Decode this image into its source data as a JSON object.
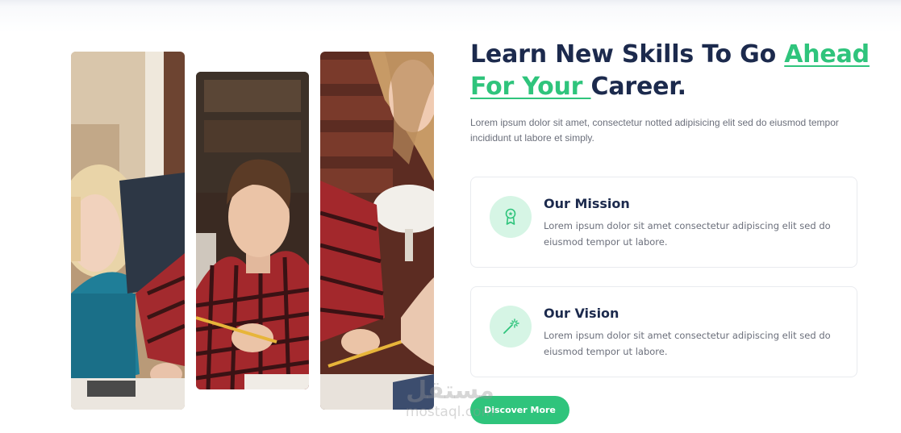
{
  "about": {
    "heading_part1": "Learn New Skills To Go ",
    "heading_accent": "Ahead For Your ",
    "heading_part2": "Career.",
    "intro": "Lorem ipsum dolor sit amet, consectetur notted adipisicing elit sed do eiusmod tempor incididunt ut labore et simply.",
    "cards": [
      {
        "icon": "award-icon",
        "title": "Our Mission",
        "text": "Lorem ipsum dolor sit amet consectetur adipiscing elit sed do eiusmod tempor ut labore."
      },
      {
        "icon": "magic-wand-icon",
        "title": "Our Vision",
        "text": "Lorem ipsum dolor sit amet consectetur adipiscing elit sed do eiusmod tempor ut labore."
      }
    ],
    "cta_label": "Discover More"
  },
  "images": [
    {
      "name": "photo-strip-left",
      "subject": "student girl writing"
    },
    {
      "name": "photo-strip-middle",
      "subject": "student boy writing with pencil"
    },
    {
      "name": "photo-strip-right",
      "subject": "student girl in library"
    }
  ],
  "watermark": {
    "arabic": "مستقل",
    "latin": "mostaql.com"
  },
  "colors": {
    "accent": "#2fc47c",
    "heading": "#1c2a4d",
    "body_text": "#6b6f7b",
    "icon_bg": "#d6f5e5",
    "card_border": "#e9ebef"
  }
}
